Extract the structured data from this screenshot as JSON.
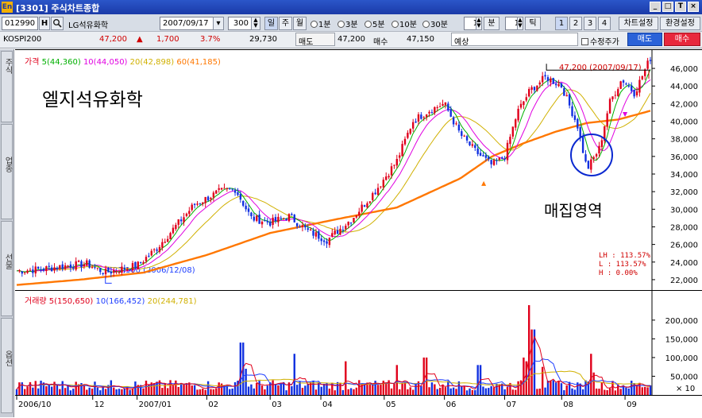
{
  "window": {
    "title": "[3301] 주식차트종합",
    "logo": "En",
    "controls": [
      "_",
      "□",
      "T",
      "×"
    ]
  },
  "toolbar": {
    "code": "012990",
    "code_btn": "H",
    "stock_name": "LG석유화학",
    "date": "2007/09/17",
    "count": "300",
    "period_buttons": [
      "일",
      "주",
      "월"
    ],
    "minute_options": [
      "1분",
      "3분",
      "5분",
      "10분",
      "30분"
    ],
    "min_value": "1",
    "min_unit": "분",
    "tick_value": "1",
    "tick_unit": "틱",
    "layout_buttons": [
      "1",
      "2",
      "3",
      "4"
    ],
    "chart_settings": "차트설정",
    "env_settings": "환경설정"
  },
  "quote": {
    "index": "KOSPI200",
    "price": "47,200",
    "change_arrow": "▲",
    "change": "1,700",
    "change_pct": "3.7%",
    "volume": "29,730",
    "ask_label": "매도",
    "ask": "47,200",
    "bid_label": "매수",
    "bid": "47,150",
    "expected_label": "예상",
    "edit_price_label": "수정주가",
    "sell_button": "매도",
    "buy_button": "매수"
  },
  "sidebar": {
    "tabs": [
      "주식",
      "업종",
      "선물",
      "옵션"
    ]
  },
  "price_panel": {
    "legend": [
      {
        "label": "가격",
        "color": "#e0001b"
      },
      {
        "label": "5(44,360)",
        "color": "#00b000"
      },
      {
        "label": "10(44,050)",
        "color": "#e000e0"
      },
      {
        "label": "20(42,898)",
        "color": "#d0b000"
      },
      {
        "label": "60(41,185)",
        "color": "#ff7700"
      }
    ],
    "stock_title": "엘지석유화학",
    "annotation": "매집영역",
    "max_label": "47,200 (2007/09/17)",
    "min_label": "22,100 (2006/12/08)",
    "stats": [
      "LH : 113.57%",
      "L  : 113.57%",
      "H  :   0.00%"
    ]
  },
  "volume_panel": {
    "legend": [
      {
        "label": "거래량",
        "color": "#e0001b"
      },
      {
        "label": "5(150,650)",
        "color": "#e0001b"
      },
      {
        "label": "10(166,452)",
        "color": "#2040ff"
      },
      {
        "label": "20(244,781)",
        "color": "#d0b000"
      }
    ],
    "unit_label": "× 10"
  },
  "x_axis": {
    "labels": [
      "2006/10",
      "12",
      "2007/01",
      "02",
      "03",
      "04",
      "05",
      "06",
      "07",
      "08",
      "09"
    ]
  },
  "chart_data": {
    "type": "candlestick",
    "x_ticks": [
      "2006/10",
      "12",
      "2007/01",
      "02",
      "03",
      "04",
      "05",
      "06",
      "07",
      "08",
      "09"
    ],
    "price_yticks": [
      22000,
      24000,
      26000,
      28000,
      30000,
      32000,
      34000,
      36000,
      38000,
      40000,
      42000,
      44000,
      46000
    ],
    "price_ylim": [
      21000,
      47000
    ],
    "price_path": [
      [
        0,
        23000
      ],
      [
        0.04,
        23200
      ],
      [
        0.08,
        23600
      ],
      [
        0.11,
        23800
      ],
      [
        0.14,
        22800
      ],
      [
        0.17,
        23300
      ],
      [
        0.19,
        23600
      ],
      [
        0.22,
        25500
      ],
      [
        0.25,
        28000
      ],
      [
        0.28,
        30500
      ],
      [
        0.32,
        32000
      ],
      [
        0.345,
        32300
      ],
      [
        0.37,
        29000
      ],
      [
        0.4,
        28500
      ],
      [
        0.43,
        29200
      ],
      [
        0.46,
        27500
      ],
      [
        0.49,
        26500
      ],
      [
        0.53,
        29000
      ],
      [
        0.565,
        32000
      ],
      [
        0.6,
        35500
      ],
      [
        0.625,
        40000
      ],
      [
        0.65,
        41200
      ],
      [
        0.675,
        42000
      ],
      [
        0.7,
        38500
      ],
      [
        0.725,
        36500
      ],
      [
        0.75,
        35000
      ],
      [
        0.77,
        36000
      ],
      [
        0.79,
        41000
      ],
      [
        0.81,
        43500
      ],
      [
        0.835,
        45000
      ],
      [
        0.86,
        44000
      ],
      [
        0.885,
        39500
      ],
      [
        0.9,
        34500
      ],
      [
        0.92,
        37000
      ],
      [
        0.935,
        42000
      ],
      [
        0.955,
        44800
      ],
      [
        0.975,
        43200
      ],
      [
        1.0,
        47200
      ]
    ],
    "ma60_path": [
      [
        0,
        21400
      ],
      [
        0.1,
        22000
      ],
      [
        0.2,
        22800
      ],
      [
        0.3,
        24800
      ],
      [
        0.4,
        27300
      ],
      [
        0.5,
        28800
      ],
      [
        0.6,
        30200
      ],
      [
        0.7,
        33500
      ],
      [
        0.75,
        36000
      ],
      [
        0.8,
        37500
      ],
      [
        0.85,
        38800
      ],
      [
        0.9,
        39800
      ],
      [
        0.95,
        40200
      ],
      [
        1.0,
        41185
      ]
    ],
    "volume_yticks": [
      50000,
      100000,
      150000,
      200000
    ],
    "volume_ylim": [
      0,
      240000
    ],
    "volume_spikes": [
      [
        0.355,
        140000
      ],
      [
        0.36,
        70000
      ],
      [
        0.44,
        110000
      ],
      [
        0.52,
        90000
      ],
      [
        0.6,
        80000
      ],
      [
        0.645,
        100000
      ],
      [
        0.73,
        80000
      ],
      [
        0.8,
        100000
      ],
      [
        0.805,
        90000
      ],
      [
        0.81,
        240000
      ],
      [
        0.815,
        175000
      ],
      [
        0.83,
        75000
      ],
      [
        0.905,
        110000
      ],
      [
        0.91,
        60000
      ]
    ],
    "series": [
      {
        "name": "5",
        "value": "150,650"
      },
      {
        "name": "10",
        "value": "166,452"
      },
      {
        "name": "20",
        "value": "244,781"
      }
    ]
  }
}
